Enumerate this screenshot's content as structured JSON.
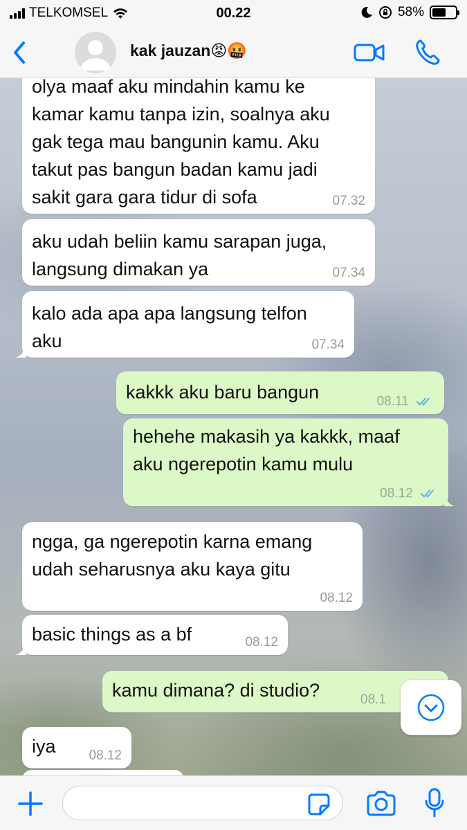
{
  "status_bar": {
    "carrier": "TELKOMSEL",
    "time": "00.22",
    "battery_percent": "58%",
    "battery_level": 0.58
  },
  "header": {
    "contact_name": "kak jauzan😡🤬"
  },
  "messages": [
    {
      "direction": "in",
      "text_lines": [
        "olya maaf aku mindahin kamu ke",
        "kamar kamu tanpa izin, soalnya aku",
        "gak tega mau bangunin kamu. Aku",
        "takut pas bangun badan kamu jadi",
        "sakit gara gara tidur di sofa"
      ],
      "time": "07.32"
    },
    {
      "direction": "in",
      "text_lines": [
        "aku udah beliin kamu sarapan juga,",
        "langsung dimakan ya"
      ],
      "time": "07.34"
    },
    {
      "direction": "in",
      "text_lines": [
        "kalo ada apa apa langsung telfon",
        "aku"
      ],
      "time": "07.34"
    },
    {
      "direction": "out",
      "text_lines": [
        "kakkk aku baru bangun"
      ],
      "time": "08.11",
      "status": "read"
    },
    {
      "direction": "out",
      "text_lines": [
        "hehehe makasih ya kakkk, maaf",
        "aku ngerepotin kamu mulu"
      ],
      "time": "08.12",
      "status": "read"
    },
    {
      "direction": "in",
      "text_lines": [
        "ngga, ga ngerepotin karna emang",
        "udah seharusnya aku kaya gitu"
      ],
      "time": "08.12"
    },
    {
      "direction": "in",
      "text_lines": [
        "basic things as a bf"
      ],
      "time": "08.12"
    },
    {
      "direction": "out",
      "text_lines": [
        "kamu dimana? di studio?"
      ],
      "time": "08.1"
    },
    {
      "direction": "in",
      "text_lines": [
        "iya"
      ],
      "time": "08.12"
    }
  ],
  "colors": {
    "accent": "#007aff",
    "incoming_bubble": "#ffffff",
    "outgoing_bubble": "#dcf8c6",
    "read_ticks": "#4fb6ec"
  },
  "icons": [
    "back-chevron-icon",
    "avatar-placeholder-icon",
    "video-camera-icon",
    "phone-icon",
    "chevron-down-icon",
    "plus-icon",
    "sticker-icon",
    "camera-icon",
    "microphone-icon"
  ]
}
